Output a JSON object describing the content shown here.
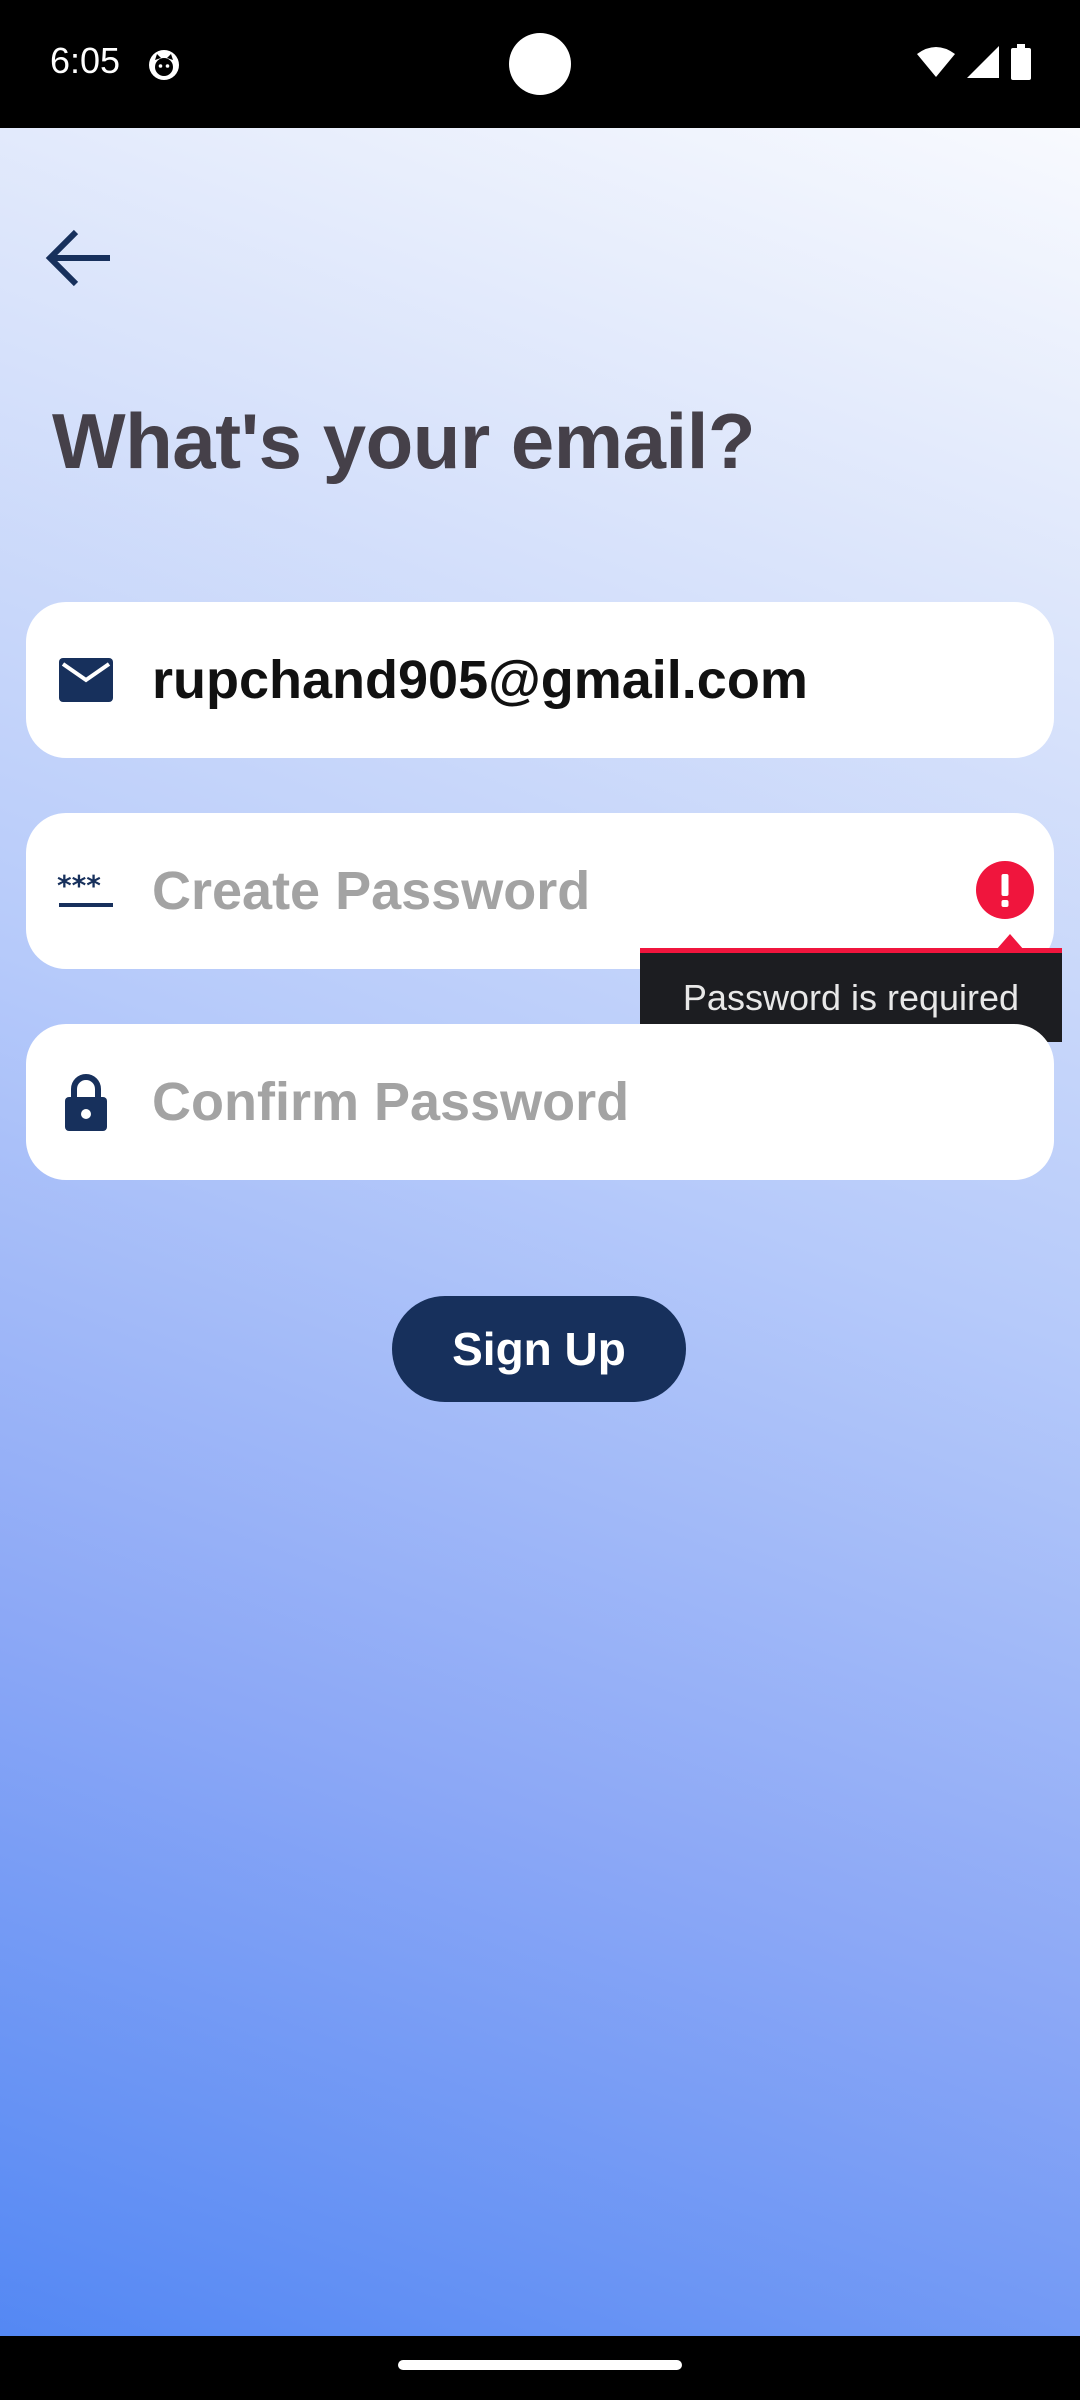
{
  "status_bar": {
    "time": "6:05",
    "icons": [
      "cat-notification-icon",
      "wifi-icon",
      "signal-icon",
      "battery-icon"
    ]
  },
  "header": {
    "back_icon": "arrow-back-icon"
  },
  "page": {
    "title": "What's your email?"
  },
  "form": {
    "email": {
      "value": "rupchand905@gmail.com",
      "icon": "mail-icon"
    },
    "password": {
      "placeholder": "Create Password",
      "icon": "password-dots-icon",
      "error_icon": "error-icon",
      "error_message": "Password is required"
    },
    "confirm_password": {
      "placeholder": "Confirm Password",
      "icon": "lock-icon"
    },
    "submit_label": "Sign Up"
  },
  "colors": {
    "primary": "#17305c",
    "error": "#f0153d",
    "title": "#454049",
    "placeholder": "#a3a3a3",
    "gradient_end": "#4f85f3"
  }
}
